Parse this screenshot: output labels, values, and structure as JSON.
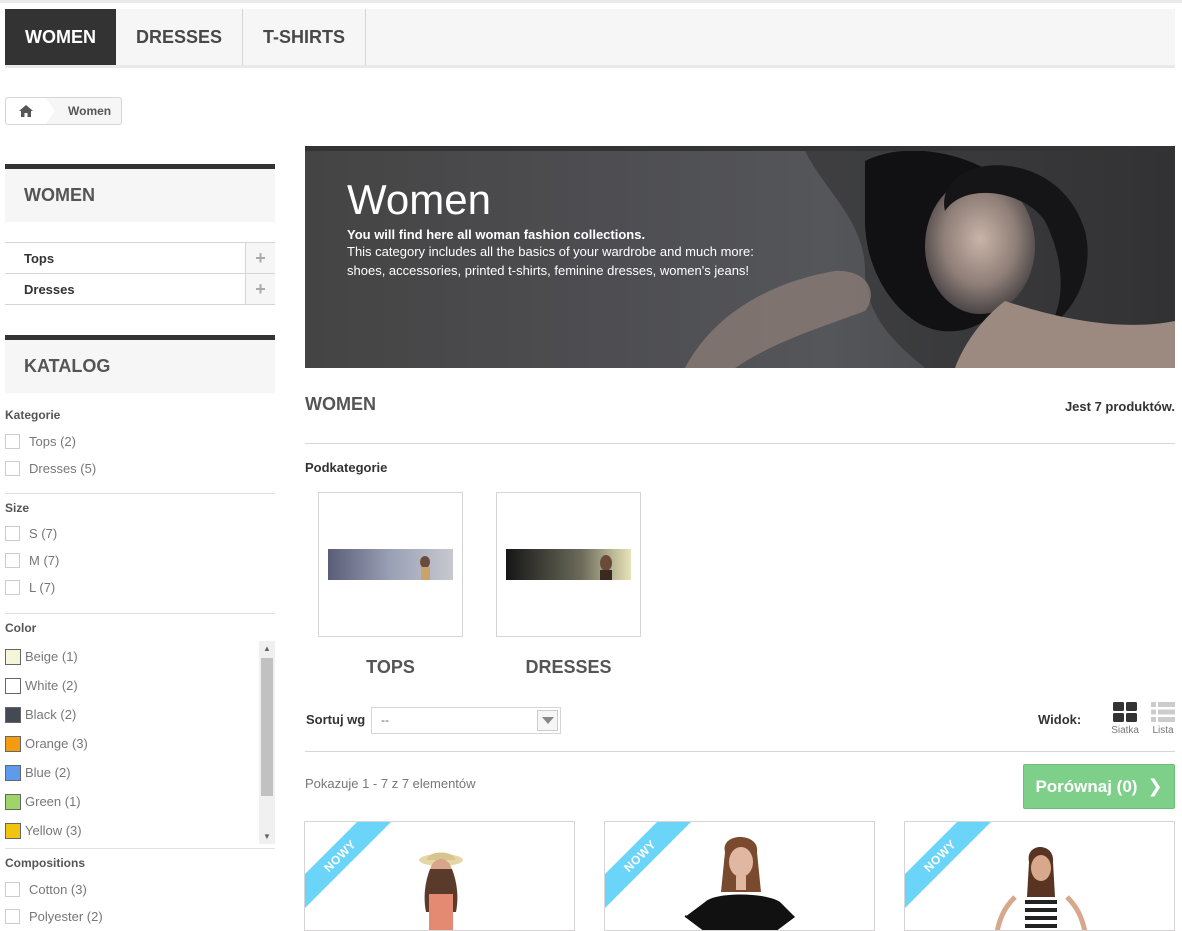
{
  "topmenu": {
    "items": [
      {
        "label": "WOMEN",
        "active": true
      },
      {
        "label": "DRESSES"
      },
      {
        "label": "T-SHIRTS"
      }
    ]
  },
  "breadcrumb": {
    "home_icon": "home-icon",
    "current": "Women"
  },
  "sidebar": {
    "category_block_title": "WOMEN",
    "categories": [
      {
        "label": "Tops"
      },
      {
        "label": "Dresses"
      }
    ],
    "catalog_title": "KATALOG",
    "filters": {
      "category": {
        "title": "Kategorie",
        "items": [
          "Tops (2)",
          "Dresses (5)"
        ]
      },
      "size": {
        "title": "Size",
        "items": [
          "S (7)",
          "M (7)",
          "L (7)"
        ]
      },
      "color": {
        "title": "Color",
        "items": [
          {
            "label": "Beige (1)",
            "color": "#f5f5dc"
          },
          {
            "label": "White (2)",
            "color": "#ffffff"
          },
          {
            "label": "Black (2)",
            "color": "#434A54"
          },
          {
            "label": "Orange (3)",
            "color": "#F39C11"
          },
          {
            "label": "Blue (2)",
            "color": "#5D9CEC"
          },
          {
            "label": "Green (1)",
            "color": "#A0D468"
          },
          {
            "label": "Yellow (3)",
            "color": "#F1C40F"
          }
        ]
      },
      "compositions": {
        "title": "Compositions",
        "items": [
          "Cotton (3)",
          "Polyester (2)"
        ]
      }
    }
  },
  "banner": {
    "title": "Women",
    "lead": "You will find here all woman fashion collections.",
    "description": "This category includes all the basics of your wardrobe and much more: shoes, accessories, printed t-shirts, feminine dresses, women's jeans!"
  },
  "category": {
    "name": "WOMEN",
    "count_text": "Jest 7 produktów."
  },
  "subcategories": {
    "label": "Podkategorie",
    "items": [
      {
        "name": "TOPS"
      },
      {
        "name": "DRESSES"
      }
    ]
  },
  "sort": {
    "label": "Sortuj wg",
    "selected": "--"
  },
  "view": {
    "label": "Widok:",
    "grid": "Siatka",
    "list": "Lista"
  },
  "listing": {
    "shown_text": "Pokazuje 1 - 7 z 7 elementów",
    "compare_label": "Porównaj (0)"
  },
  "products": [
    {
      "badge": "NOWY"
    },
    {
      "badge": "NOWY"
    },
    {
      "badge": "NOWY"
    }
  ],
  "colors": {
    "accent_green": "#7dcf89",
    "ribbon_blue": "#6ad4f9",
    "dark": "#333333"
  }
}
